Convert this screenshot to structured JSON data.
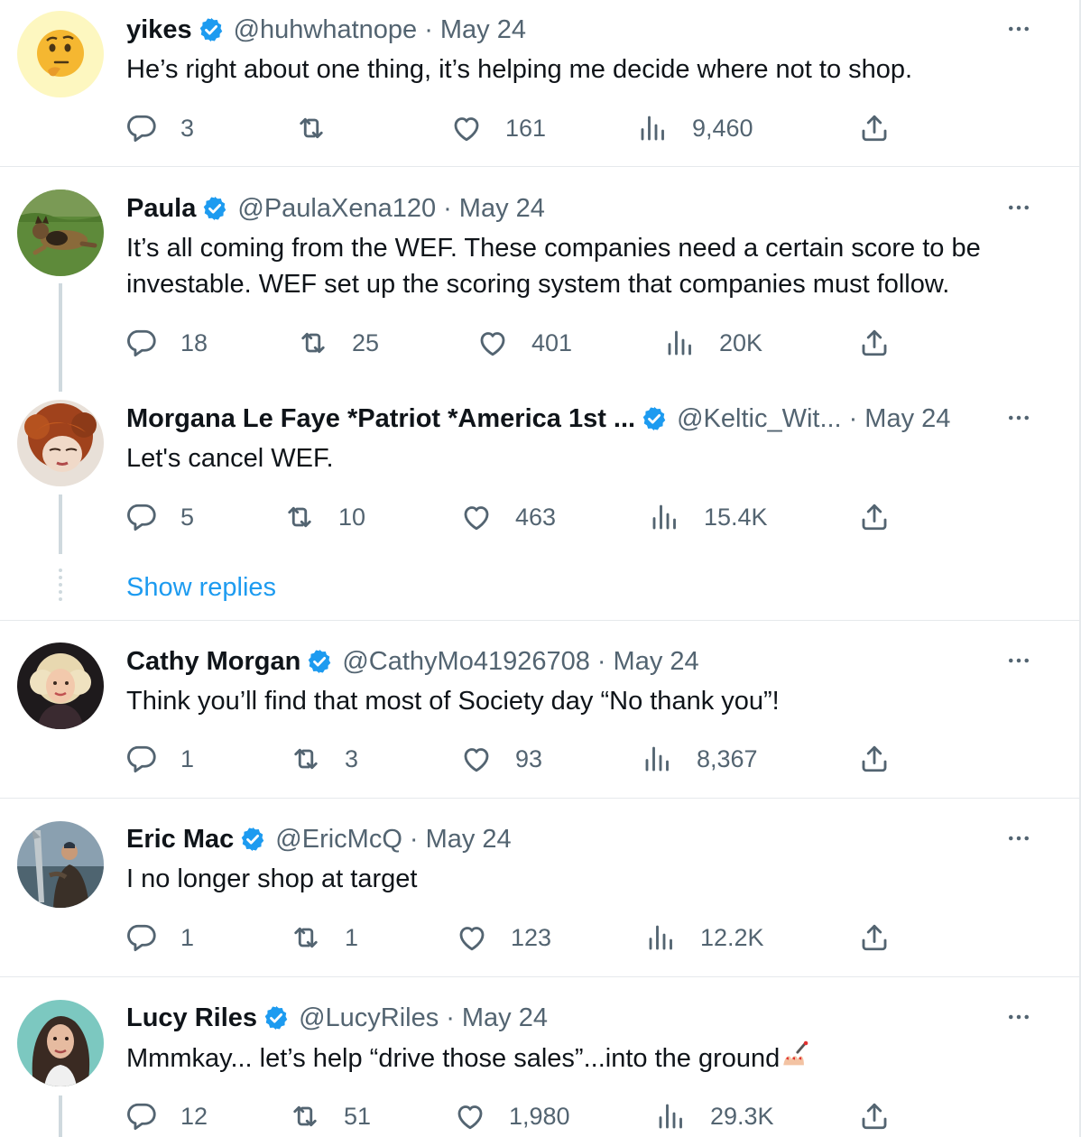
{
  "colors": {
    "verified_blue": "#1d9bf0",
    "link_blue": "#1d9bf0",
    "muted": "#536471",
    "text": "#0f1419",
    "divider": "#e6e9ec"
  },
  "icons": {
    "reply": "speech-bubble",
    "retweet": "retweet-arrows",
    "like": "heart",
    "views": "bar-chart",
    "share": "upload-arrow",
    "more": "three-dots",
    "verified": "verified-checkmark-badge"
  },
  "tweets": [
    {
      "name": "yikes",
      "handle": "@huhwhatnope",
      "sep": "·",
      "date": "May 24",
      "text": [
        "He’s right about one thing, it’s helping me decide where not to shop."
      ],
      "replies": "3",
      "retweets": "",
      "likes": "161",
      "views": "9,460",
      "avatar": "thinking-face-emoji"
    },
    {
      "name": "Paula",
      "handle": "@PaulaXena120",
      "sep": "·",
      "date": "May 24",
      "text": [
        "It’s all coming from the WEF. These companies need a certain score to be",
        "investable. WEF set up the scoring system that companies must follow."
      ],
      "replies": "18",
      "retweets": "25",
      "likes": "401",
      "views": "20K",
      "avatar": "dog-on-grass-photo"
    },
    {
      "name": "Morgana Le Faye *Patriot *America 1st ...",
      "handle": "@Keltic_Wit...",
      "sep": "·",
      "date": "May 24",
      "text": [
        "Let's cancel WEF."
      ],
      "replies": "5",
      "retweets": "10",
      "likes": "463",
      "views": "15.4K",
      "avatar": "red-haired-woman-photo"
    },
    {
      "name": "Cathy Morgan",
      "handle": "@CathyMo41926708",
      "sep": "·",
      "date": "May 24",
      "text": [
        "Think you’ll find that most of Society day “No thank you”!"
      ],
      "replies": "1",
      "retweets": "3",
      "likes": "93",
      "views": "8,367",
      "avatar": "blonde-woman-photo"
    },
    {
      "name": "Eric Mac",
      "handle": "@EricMcQ",
      "sep": "·",
      "date": "May 24",
      "text": [
        "I no longer shop at target"
      ],
      "replies": "1",
      "retweets": "1",
      "likes": "123",
      "views": "12.2K",
      "avatar": "man-with-fish-photo"
    },
    {
      "name": "Lucy Riles",
      "handle": "@LucyRiles",
      "sep": "·",
      "date": "May 24",
      "text": [
        "Mmmkay... let’s help “drive those sales”...into the ground"
      ],
      "text_emoji": "nail-polish-emoji",
      "replies": "12",
      "retweets": "51",
      "likes": "1,980",
      "views": "29.3K",
      "avatar": "dark-haired-woman-photo"
    }
  ],
  "show_replies": "Show replies"
}
